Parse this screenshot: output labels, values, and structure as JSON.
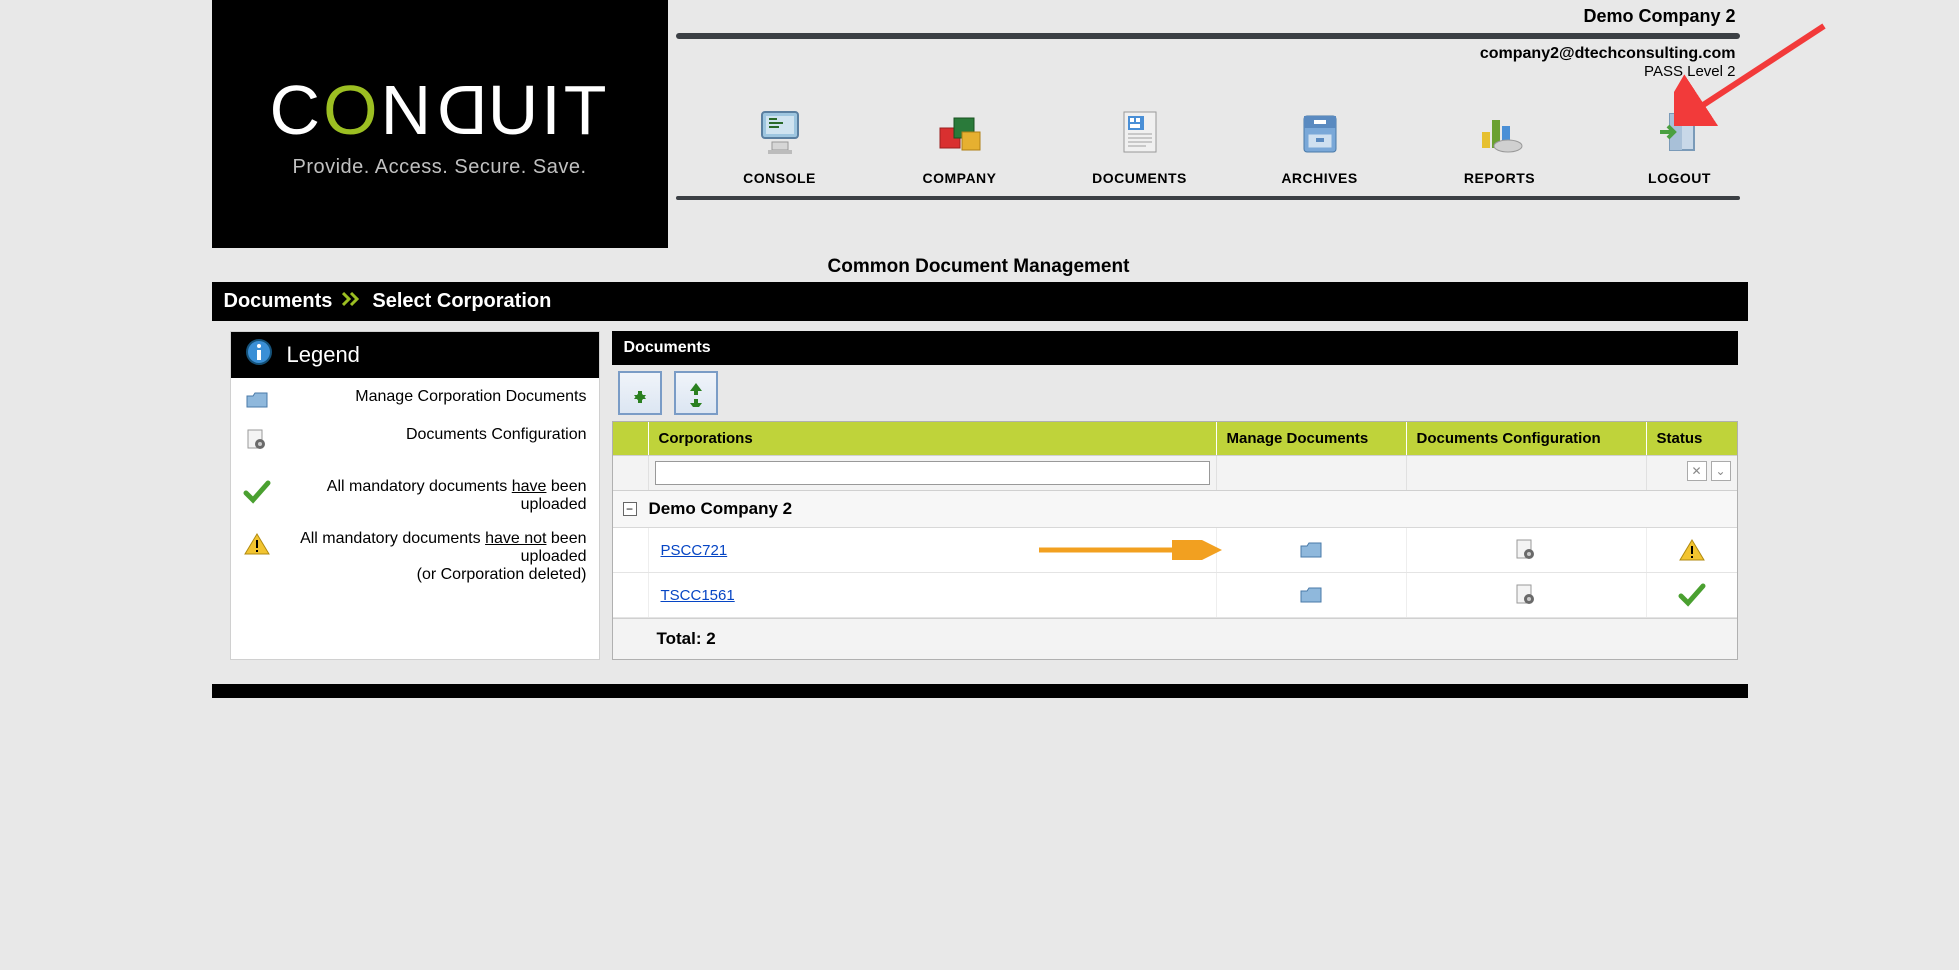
{
  "header": {
    "logo_main_c": "C",
    "logo_main_o": "O",
    "logo_main_n": "N",
    "logo_main_d_flip": "D",
    "logo_main_uit": "UIT",
    "tagline": "Provide. Access. Secure. Save.",
    "company_name": "Demo Company 2",
    "user_email": "company2@dtechconsulting.com",
    "user_level": "PASS Level 2"
  },
  "nav": {
    "console": "CONSOLE",
    "company": "COMPANY",
    "documents": "DOCUMENTS",
    "archives": "ARCHIVES",
    "reports": "REPORTS",
    "logout": "LOGOUT"
  },
  "section_heading": "Common Document Management",
  "breadcrumb": {
    "root": "Documents",
    "leaf": "Select Corporation"
  },
  "legend": {
    "title": "Legend",
    "item_manage": "Manage Corporation Documents",
    "item_config": "Documents Configuration",
    "item_all_yes_pre": "All mandatory documents ",
    "item_all_yes_u": "have",
    "item_all_yes_post": " been uploaded",
    "item_all_no_pre": "All mandatory documents ",
    "item_all_no_u": "have not",
    "item_all_no_post": " been uploaded",
    "item_all_no_paren": "(or Corporation deleted)"
  },
  "panel": {
    "header": "Documents"
  },
  "grid": {
    "col_corporations": "Corporations",
    "col_manage": "Manage Documents",
    "col_config": "Documents Configuration",
    "col_status": "Status",
    "group_name": "Demo Company 2",
    "rows": [
      {
        "name": "PSCC721",
        "status": "warn"
      },
      {
        "name": "TSCC1561",
        "status": "ok"
      }
    ],
    "footer": "Total: 2"
  }
}
